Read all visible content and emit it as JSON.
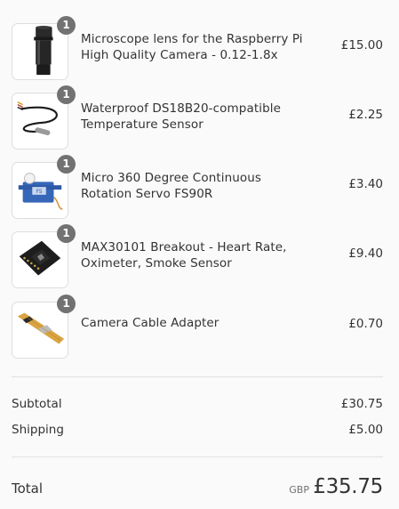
{
  "items": [
    {
      "quantity": "1",
      "name": "Microscope lens for the Raspberry Pi High Quality Camera - 0.12-1.8x",
      "price": "£15.00",
      "thumbnail": "microscope-lens-image"
    },
    {
      "quantity": "1",
      "name": "Waterproof DS18B20-compatible Temperature Sensor",
      "price": "£2.25",
      "thumbnail": "temperature-sensor-image"
    },
    {
      "quantity": "1",
      "name": "Micro 360 Degree Continuous Rotation Servo FS90R",
      "price": "£3.40",
      "thumbnail": "servo-image"
    },
    {
      "quantity": "1",
      "name": "MAX30101 Breakout - Heart Rate, Oximeter, Smoke Sensor",
      "price": "£9.40",
      "thumbnail": "breakout-board-image"
    },
    {
      "quantity": "1",
      "name": "Camera Cable Adapter",
      "price": "£0.70",
      "thumbnail": "cable-adapter-image"
    }
  ],
  "summary": {
    "subtotal_label": "Subtotal",
    "subtotal_value": "£30.75",
    "shipping_label": "Shipping",
    "shipping_value": "£5.00",
    "total_label": "Total",
    "currency": "GBP",
    "total_value": "£35.75"
  },
  "colors": {
    "background": "#fafafa",
    "text": "#333333",
    "badge": "#727272",
    "divider": "#e1e1e1"
  }
}
